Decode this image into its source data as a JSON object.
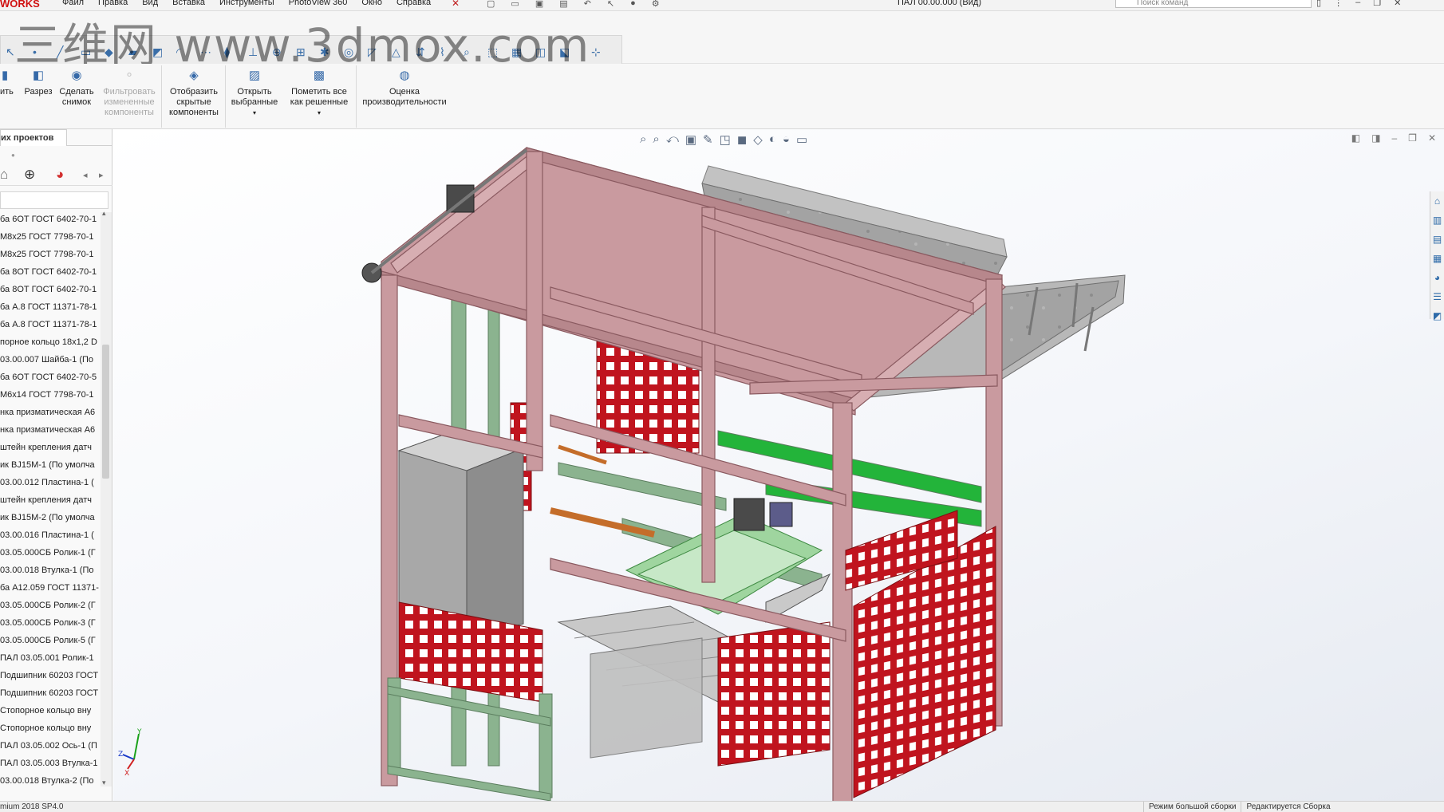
{
  "app": {
    "logo": "WORKS",
    "menus": [
      "Файл",
      "Правка",
      "Вид",
      "Вставка",
      "Инструменты",
      "PhotoView 360",
      "Окно",
      "Справка"
    ],
    "document_title": "ПАЛ 00.00.000 (Вид)",
    "search_placeholder": "Поиск команд"
  },
  "watermark": "三维网 www.3dmox.com",
  "ribbon": {
    "cut_label": "ить",
    "section": "Разрез",
    "snapshot": "Сделать снимок",
    "filter_modified": "Фильтровать измененные компоненты",
    "show_hidden": "Отобразить скрытые компоненты",
    "open_selected": "Открыть выбранные",
    "mark_resolved": "Пометить все как решенные",
    "performance": "Оценка производительности"
  },
  "left_panel": {
    "tab_label": "их проектов",
    "items": [
      "ба 6ОТ ГОСТ 6402-70-1",
      "М8х25 ГОСТ 7798-70-1",
      "М8х25 ГОСТ 7798-70-1",
      "ба 8ОТ ГОСТ 6402-70-1",
      "ба 8ОТ ГОСТ 6402-70-1",
      "ба А.8 ГОСТ 11371-78-1",
      "ба А.8 ГОСТ 11371-78-1",
      "порное кольцо 18х1,2 D",
      "03.00.007 Шайба-1 (По",
      "ба 6ОТ ГОСТ 6402-70-5",
      "М6х14 ГОСТ 7798-70-1",
      "нка призматическая А6",
      "нка призматическая А6",
      "штейн крепления датч",
      "ик BJ15M-1 (По умолча",
      "03.00.012 Пластина-1 (",
      "штейн крепления датч",
      "ик BJ15M-2 (По умолча",
      "03.00.016 Пластина-1 (",
      "03.05.000СБ Ролик-1 (Г",
      "03.00.018 Втулка-1 (По",
      "ба А12.059 ГОСТ 11371-",
      "03.05.000СБ Ролик-2 (Г",
      "03.05.000СБ Ролик-3 (Г",
      "03.05.000СБ Ролик-5 (Г",
      "ПАЛ 03.05.001 Ролик-1",
      "Подшипник 60203 ГОСТ",
      "Подшипник 60203 ГОСТ",
      "Стопорное кольцо вну",
      "Стопорное кольцо вну",
      "ПАЛ 03.05.002 Ось-1 (П",
      "ПАЛ 03.05.003 Втулка-1",
      "03.00.018 Втулка-2 (По"
    ]
  },
  "statusbar": {
    "version": "mium 2018 SP4.0",
    "mode": "Режим большой сборки",
    "state": "Редактируется Сборка"
  },
  "colors": {
    "frame": "#c99a9f",
    "frame_dark": "#9f6e74",
    "mesh": "#c0141e",
    "green_frame": "#8bb38f",
    "accent_green": "#23b43a",
    "cabinet": "#b9b9b9",
    "conveyor": "#a7a7a7"
  }
}
